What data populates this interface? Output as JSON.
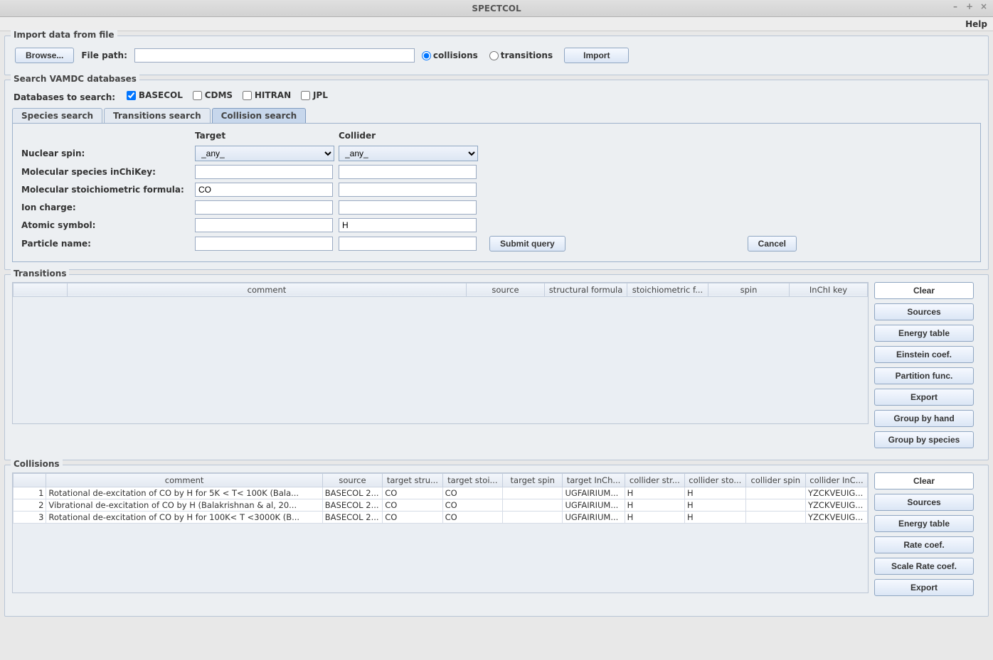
{
  "window": {
    "title": "SPECTCOL"
  },
  "menubar": {
    "help": "Help"
  },
  "import": {
    "legend": "Import data from file",
    "browse": "Browse...",
    "filepath_label": "File path:",
    "filepath_value": "",
    "radio_collisions": "collisions",
    "radio_transitions": "transitions",
    "import_btn": "Import"
  },
  "search": {
    "legend": "Search VAMDC databases",
    "db_label": "Databases to search:",
    "db": {
      "basecol": "BASECOL",
      "cdms": "CDMS",
      "hitran": "HITRAN",
      "jpl": "JPL"
    },
    "tabs": {
      "species": "Species search",
      "transitions": "Transitions search",
      "collision": "Collision search"
    },
    "collision": {
      "col_target": "Target",
      "col_collider": "Collider",
      "nuclear_spin": "Nuclear spin:",
      "inchikey": "Molecular species inChiKey:",
      "formula": "Molecular stoichiometric formula:",
      "ion_charge": "Ion charge:",
      "atomic_symbol": "Atomic symbol:",
      "particle_name": "Particle name:",
      "any": "_any_",
      "target_formula_val": "CO",
      "collider_atomic_val": "H",
      "submit": "Submit query",
      "cancel": "Cancel"
    }
  },
  "transitions": {
    "legend": "Transitions",
    "headers": [
      "",
      "comment",
      "source",
      "structural formula",
      "stoichiometric f...",
      "spin",
      "InChI key"
    ],
    "buttons": [
      "Clear",
      "Sources",
      "Energy table",
      "Einstein coef.",
      "Partition func.",
      "Export",
      "Group by hand",
      "Group by species"
    ]
  },
  "collisions": {
    "legend": "Collisions",
    "headers": [
      "",
      "comment",
      "source",
      "target stru...",
      "target stoi...",
      "target spin",
      "target InCh...",
      "collider str...",
      "collider sto...",
      "collider spin",
      "collider InC..."
    ],
    "rows": [
      {
        "n": "1",
        "comment": "Rotational de-excitation of CO by H for 5K < T< 100K (Bala...",
        "source": "BASECOL 2...",
        "tstru": "CO",
        "tstoi": "CO",
        "tspin": "",
        "tinchi": "UGFAIRIUM...",
        "cstru": "H",
        "cstoi": "H",
        "cspin": "",
        "cinchi": "YZCKVEUIG..."
      },
      {
        "n": "2",
        "comment": "Vibrational de-excitation of CO by H (Balakrishnan & al, 20...",
        "source": "BASECOL 2...",
        "tstru": "CO",
        "tstoi": "CO",
        "tspin": "",
        "tinchi": "UGFAIRIUM...",
        "cstru": "H",
        "cstoi": "H",
        "cspin": "",
        "cinchi": "YZCKVEUIG..."
      },
      {
        "n": "3",
        "comment": "Rotational de-excitation of CO by H for 100K< T <3000K (B...",
        "source": "BASECOL 2...",
        "tstru": "CO",
        "tstoi": "CO",
        "tspin": "",
        "tinchi": "UGFAIRIUM...",
        "cstru": "H",
        "cstoi": "H",
        "cspin": "",
        "cinchi": "YZCKVEUIG..."
      }
    ],
    "buttons": [
      "Clear",
      "Sources",
      "Energy table",
      "Rate coef.",
      "Scale Rate coef.",
      "Export"
    ]
  }
}
